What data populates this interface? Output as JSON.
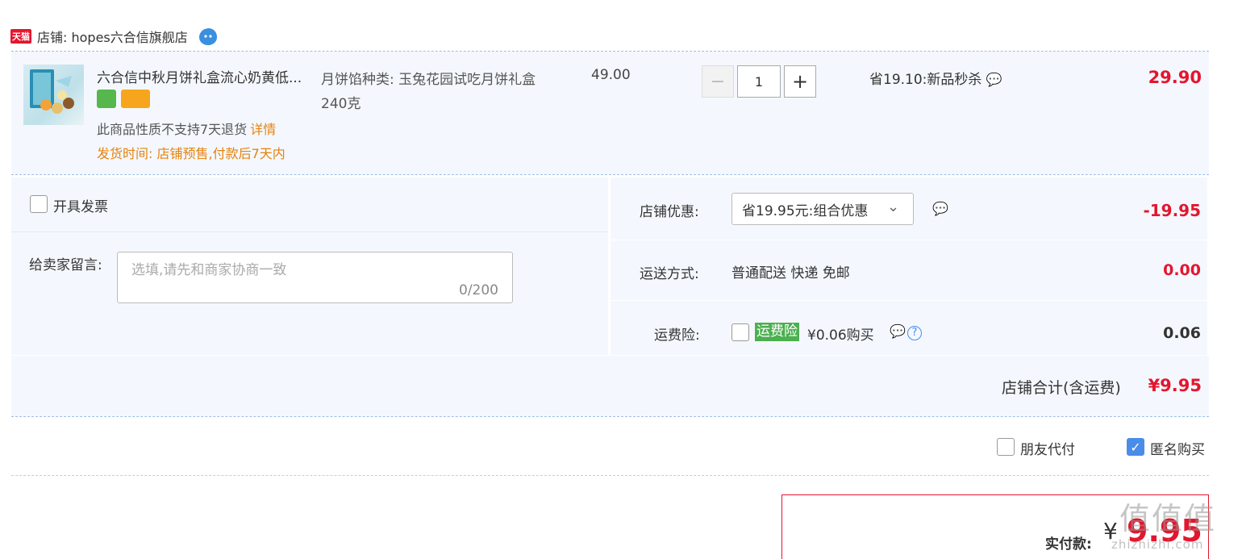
{
  "shop": {
    "badge": "天猫",
    "name": "店铺: hopes六合信旗舰店"
  },
  "product": {
    "title": "六合信中秋月饼礼盒流心奶黄低...",
    "return_policy": "此商品性质不支持7天退货",
    "details_link": "详情",
    "ship_time": "发货时间: 店铺预售,付款后7天内",
    "sku": "月饼馅种类: 玉兔花园试吃月饼礼盒240克",
    "original_price": "49.00",
    "quantity": "1",
    "minus": "−",
    "plus": "+",
    "promo": "省19.10:新品秒杀",
    "final_price": "29.90"
  },
  "order": {
    "invoice_label": "开具发票",
    "message_label": "给卖家留言:",
    "message_placeholder": "选填,请先和商家协商一致",
    "message_count": "0/200",
    "coupon_label": "店铺优惠:",
    "coupon_value": "省19.95元:组合优惠",
    "coupon_amount": "-19.95",
    "shipping_label": "运送方式:",
    "shipping_value": "普通配送 快递 免邮",
    "shipping_amount": "0.00",
    "insurance_label": "运费险:",
    "insurance_tag": "运费险",
    "insurance_price": "¥0.06购买",
    "insurance_amount": "0.06",
    "total_label": "店铺合计(含运费)",
    "total_amount": "¥9.95"
  },
  "options": {
    "friend_pay": "朋友代付",
    "anonymous": "匿名购买",
    "anonymous_checked": true
  },
  "payment": {
    "label": "实付款:",
    "currency": "¥",
    "amount": "9.95"
  },
  "watermark": {
    "text": "值值值",
    "sub": "zhizhizhi.com"
  },
  "icons": [
    "tmall-badge",
    "wangwang-icon",
    "chat-icon",
    "help-icon",
    "chevron-down-icon",
    "check-icon"
  ],
  "colors": {
    "accent_red": "#e4162e",
    "orange": "#e6820e",
    "panel_bg": "#f4f8fe",
    "checkbox_blue": "#4a8de8",
    "insurance_green": "#4caf50"
  }
}
